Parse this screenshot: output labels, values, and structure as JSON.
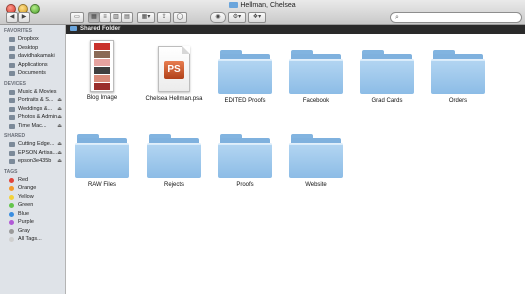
{
  "window": {
    "title": "Hellman, Chelsea"
  },
  "toolbar": {
    "back_icon": "chevron-left-icon",
    "forward_icon": "chevron-right-icon",
    "search_placeholder": ""
  },
  "pathbar": {
    "label": "Shared Folder"
  },
  "sidebar": {
    "sections": [
      {
        "title": "FAVORITES",
        "items": [
          {
            "label": "Dropbox",
            "icon": "dropbox-icon"
          },
          {
            "label": "Desktop",
            "icon": "desktop-icon"
          },
          {
            "label": "davidhakamaki",
            "icon": "home-icon"
          },
          {
            "label": "Applications",
            "icon": "applications-icon"
          },
          {
            "label": "Documents",
            "icon": "documents-icon"
          }
        ]
      },
      {
        "title": "DEVICES",
        "items": [
          {
            "label": "Music & Movies",
            "icon": "disk-icon"
          },
          {
            "label": "Portraits & S...",
            "icon": "disk-icon"
          },
          {
            "label": "Weddings &...",
            "icon": "disk-icon"
          },
          {
            "label": "Photos & Admin",
            "icon": "disk-icon"
          },
          {
            "label": "Time Mac...",
            "icon": "disk-icon"
          }
        ]
      },
      {
        "title": "SHARED",
        "items": [
          {
            "label": "Cutting Edge...",
            "icon": "server-icon"
          },
          {
            "label": "EPSON Artisa...",
            "icon": "server-icon"
          },
          {
            "label": "epson3e435b",
            "icon": "server-icon"
          }
        ]
      },
      {
        "title": "TAGS",
        "items": [
          {
            "label": "Red",
            "color": "#e0443a"
          },
          {
            "label": "Orange",
            "color": "#f39a2b"
          },
          {
            "label": "Yellow",
            "color": "#f2d23b"
          },
          {
            "label": "Green",
            "color": "#63c44b"
          },
          {
            "label": "Blue",
            "color": "#3b8ee0"
          },
          {
            "label": "Purple",
            "color": "#b15ad6"
          },
          {
            "label": "Gray",
            "color": "#9a9a9a"
          },
          {
            "label": "All Tags...",
            "color": "#cfcfcf"
          }
        ]
      }
    ]
  },
  "files": [
    {
      "name": "Blog Image",
      "kind": "image"
    },
    {
      "name": "Chelsea Hellman.psa",
      "kind": "psd"
    },
    {
      "name": "EDITED Proofs",
      "kind": "folder"
    },
    {
      "name": "Facebook",
      "kind": "folder"
    },
    {
      "name": "Grad Cards",
      "kind": "folder"
    },
    {
      "name": "Orders",
      "kind": "folder"
    },
    {
      "name": "RAW Files",
      "kind": "folder"
    },
    {
      "name": "Rejects",
      "kind": "folder"
    },
    {
      "name": "Proofs",
      "kind": "folder"
    },
    {
      "name": "Website",
      "kind": "folder"
    }
  ]
}
